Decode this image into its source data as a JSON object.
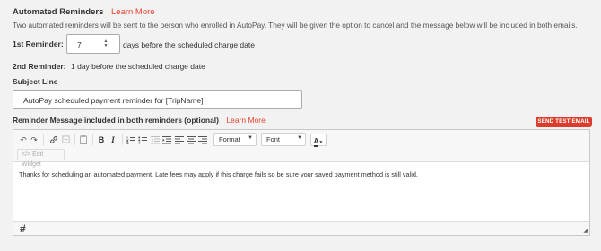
{
  "header": {
    "title": "Automated Reminders",
    "learn_more": "Learn More",
    "description": "Two automated reminders will be sent to the person who enrolled in AutoPay. They will be given the option to cancel and the message below will be included in both emails."
  },
  "reminder1": {
    "label": "1st Reminder:",
    "value": "7",
    "suffix": "days before the scheduled charge date"
  },
  "reminder2": {
    "label": "2nd Reminder:",
    "text": "1 day before the scheduled charge date"
  },
  "subject": {
    "label": "Subject Line",
    "value": "AutoPay scheduled payment reminder for [TripName]"
  },
  "message": {
    "label": "Reminder Message included in both reminders (optional)",
    "learn_more": "Learn More",
    "send_test": "SEND TEST EMAIL"
  },
  "editor": {
    "toolbar": {
      "format_label": "Format",
      "font_label": "Font",
      "edit_widget": "Edit Widget",
      "icons": [
        "undo-icon",
        "redo-icon",
        "link-icon",
        "unlink-icon",
        "paste-icon",
        "bold-icon",
        "italic-icon",
        "numbered-list-icon",
        "bullet-list-icon",
        "outdent-icon",
        "indent-icon",
        "align-left-icon",
        "align-center-icon",
        "align-right-icon",
        "text-color-icon"
      ]
    },
    "content": "Thanks for scheduling an automated payment. Late fees may apply if this charge fails so be sure your saved payment method is still valid.",
    "statusbar_icon": "hash-icon"
  },
  "colors": {
    "accent": "#dd3b2b",
    "link": "#e8432e",
    "background": "#f2f2f2"
  }
}
